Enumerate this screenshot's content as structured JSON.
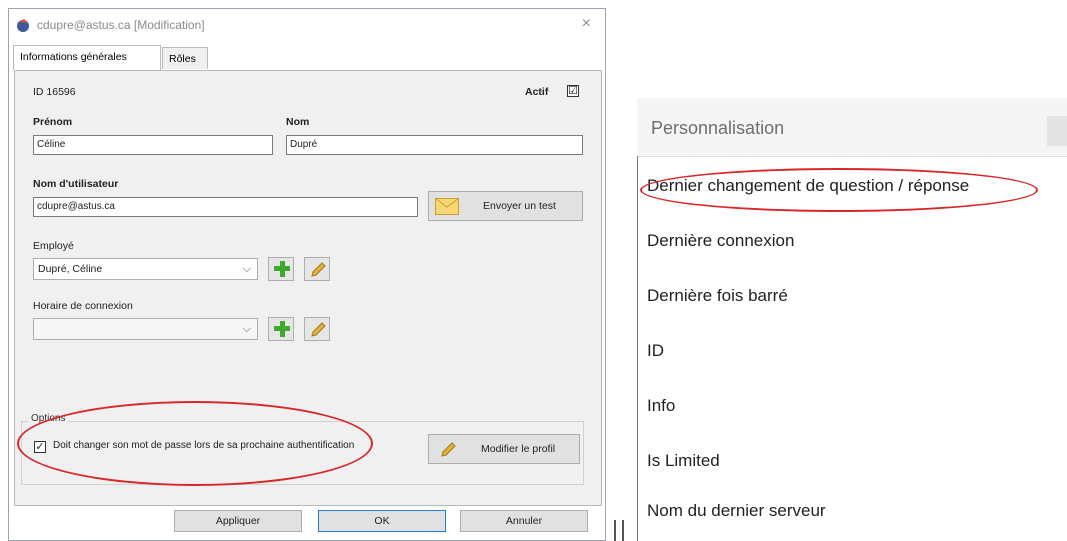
{
  "dialog": {
    "title": "cdupre@astus.ca [Modification]",
    "close_glyph": "×",
    "tabs": [
      {
        "label": "Informations générales"
      },
      {
        "label": "Rôles"
      }
    ],
    "id_label": "ID 16596",
    "actif_label": "Actif",
    "actif_checked": "☑",
    "prenom_label": "Prénom",
    "prenom_value": "Céline",
    "nom_label": "Nom",
    "nom_value": "Dupré",
    "username_label": "Nom d'utilisateur",
    "username_value": "cdupre@astus.ca",
    "send_test_label": "Envoyer un test",
    "employe_label": "Employé",
    "employe_value": "Dupré, Céline",
    "horaire_label": "Horaire de connexion",
    "horaire_value": "",
    "options_label": "Options",
    "must_change_label": "Doit changer son mot de passe lors de sa prochaine authentification",
    "must_change_checked": "✓",
    "modify_profile_label": "Modifier le profil",
    "footer": {
      "apply": "Appliquer",
      "ok": "OK",
      "cancel": "Annuler"
    },
    "chevron_glyph": "⌵"
  },
  "personnalisation": {
    "title": "Personnalisation",
    "items": [
      {
        "label": "Dernier changement de question / réponse"
      },
      {
        "label": "Dernière connexion"
      },
      {
        "label": "Dernière fois barré"
      },
      {
        "label": "ID"
      },
      {
        "label": "Info"
      },
      {
        "label": "Is Limited"
      },
      {
        "label": "Nom du dernier serveur"
      }
    ]
  },
  "colors": {
    "highlight_ellipse": "#d9262a",
    "plus_green": "#3fa82f",
    "pencil_yellow": "#e2b33a"
  },
  "icons": [
    "app-icon",
    "close-icon",
    "envelope-icon",
    "chevron-down-icon",
    "add-icon",
    "pencil-icon",
    "checkbox-icon"
  ]
}
